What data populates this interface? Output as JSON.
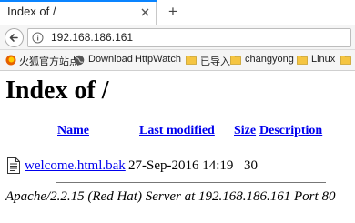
{
  "browser": {
    "tab": {
      "title": "Index of /"
    },
    "new_tab_symbol": "+",
    "address_bar": {
      "url": "192.168.186.161"
    },
    "bookmarks": [
      {
        "label": "火狐官方站点",
        "icon": "firefox-icon"
      },
      {
        "label": "Download",
        "icon": "globe-icon"
      },
      {
        "label": "HttpWatch",
        "icon": ""
      },
      {
        "label": "已导入",
        "icon": "folder-icon"
      },
      {
        "label": "changyong",
        "icon": "folder-icon"
      },
      {
        "label": "Linux",
        "icon": "folder-icon"
      }
    ],
    "colors": {
      "tab_accent": "#0a84ff",
      "folder": "#f5c542",
      "link": "#0000ee"
    }
  },
  "page": {
    "title": "Index of /",
    "columns": [
      "Name",
      "Last modified",
      "Size",
      "Description"
    ],
    "rows": [
      {
        "name": "welcome.html.bak",
        "modified": "27-Sep-2016 14:19",
        "size": "30",
        "description": "",
        "icon": "file-text-icon"
      }
    ],
    "footer": "Apache/2.2.15 (Red Hat) Server at 192.168.186.161 Port 80"
  }
}
